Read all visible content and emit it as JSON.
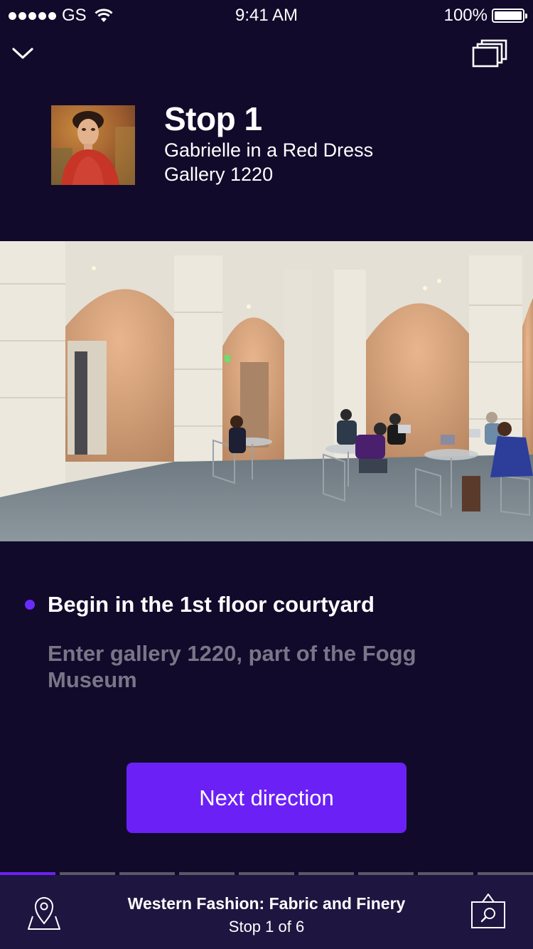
{
  "status_bar": {
    "carrier": "GS",
    "time": "9:41 AM",
    "battery": "100%",
    "battery_level": 1.0
  },
  "header": {
    "stop_title": "Stop 1",
    "artwork_title": "Gabrielle in a Red Dress",
    "gallery": "Gallery 1220"
  },
  "direction": {
    "title": "Begin in the 1st floor courtyard",
    "description": "Enter gallery 1220, part of the Fogg Museum"
  },
  "cta": {
    "label": "Next direction"
  },
  "progress": {
    "current": 1,
    "total": 9
  },
  "footer": {
    "tour_name": "Western Fashion: Fabric and Finery",
    "stop_progress": "Stop 1 of 6"
  },
  "icons": {
    "collapse": "chevron-down-icon",
    "gallery": "stacked-images-icon",
    "map": "map-pin-icon",
    "find": "bag-search-icon"
  },
  "colors": {
    "background": "#110a2b",
    "accent": "#6b21f5",
    "bottom_bar": "#1e1540",
    "muted_text": "#7a7587"
  }
}
